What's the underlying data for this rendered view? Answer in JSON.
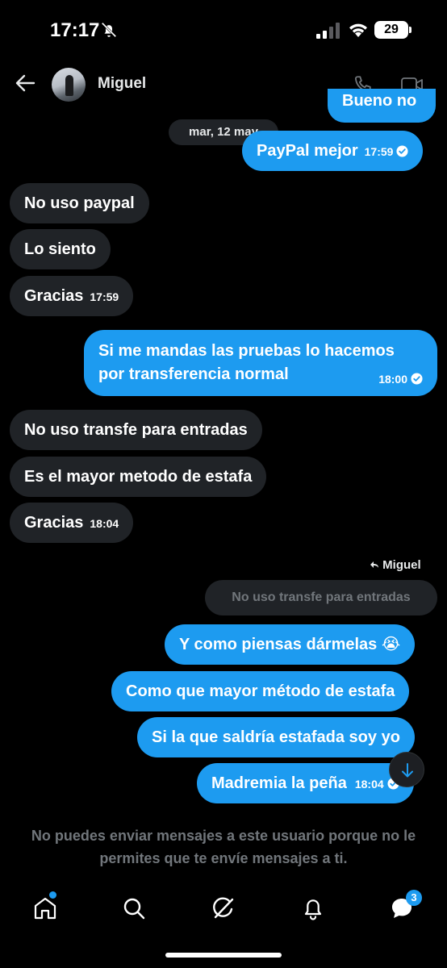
{
  "status_bar": {
    "time": "17:17",
    "battery": "29"
  },
  "header": {
    "contact_name": "Miguel"
  },
  "conversation": {
    "partial_message": "Bueno no",
    "date_separator": "mar, 12 may",
    "messages": [
      {
        "direction": "out",
        "text": "PayPal mejor",
        "time": "17:59",
        "read": true
      },
      {
        "direction": "in",
        "text": "No uso paypal"
      },
      {
        "direction": "in",
        "text": "Lo siento"
      },
      {
        "direction": "in",
        "text": "Gracias",
        "time": "17:59"
      },
      {
        "direction": "out",
        "text_lines": [
          "Si me mandas las pruebas lo hacemos",
          "por transferencia normal"
        ],
        "time": "18:00",
        "read": true
      },
      {
        "direction": "in",
        "text": "No uso transfe para entradas"
      },
      {
        "direction": "in",
        "text": "Es el mayor metodo de estafa"
      },
      {
        "direction": "in",
        "text": "Gracias",
        "time": "18:04"
      },
      {
        "direction": "out",
        "text": "Y como piensas dármelas 😭"
      },
      {
        "direction": "out",
        "text": "Como que mayor método de estafa"
      },
      {
        "direction": "out",
        "text": "Si la que saldría estafada soy yo"
      },
      {
        "direction": "out",
        "text": "Madremia la peña",
        "time": "18:04",
        "read": true
      }
    ],
    "reply_to": {
      "label": "Miguel",
      "quoted_text": "No uso transfe para entradas"
    }
  },
  "notice": "No puedes enviar mensajes a este usuario porque no le permites que te envíe mensajes a ti.",
  "nav": {
    "items": [
      "home-icon",
      "search-icon",
      "grok-icon",
      "notifications-icon",
      "messages-icon"
    ],
    "messages_badge": "3"
  },
  "colors": {
    "accent": "#1d9bf0",
    "incoming_bubble": "#202327",
    "background": "#000000",
    "muted": "#71767b"
  }
}
